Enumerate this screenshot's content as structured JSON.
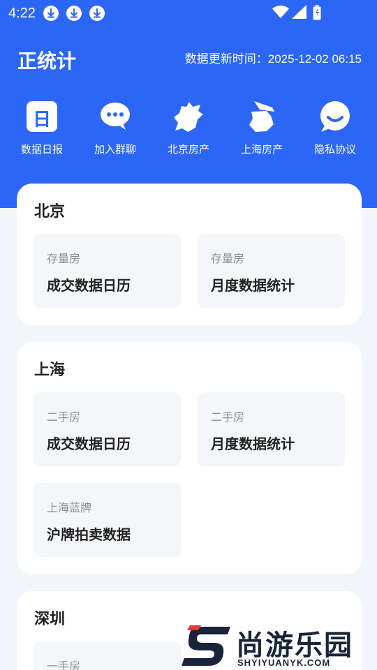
{
  "status_bar": {
    "time": "4:22",
    "notification_icons": [
      "download-icon",
      "download-icon",
      "download-icon"
    ],
    "system_icons": [
      "wifi-icon",
      "signal-icon",
      "battery-icon"
    ]
  },
  "header": {
    "title": "正统计",
    "update_label": "数据更新时间：",
    "update_time": "2025-12-02 06:15"
  },
  "shortcuts": [
    {
      "label": "数据日报",
      "icon": "calendar-day-icon",
      "glyph": "日"
    },
    {
      "label": "加入群聊",
      "icon": "chat-bubble-icon"
    },
    {
      "label": "北京房产",
      "icon": "beijing-map-icon"
    },
    {
      "label": "上海房产",
      "icon": "shanghai-map-icon"
    },
    {
      "label": "隐私协议",
      "icon": "smile-bubble-icon"
    }
  ],
  "cities": [
    {
      "name": "北京",
      "tiles": [
        {
          "sub": "存量房",
          "main": "成交数据日历"
        },
        {
          "sub": "存量房",
          "main": "月度数据统计"
        }
      ]
    },
    {
      "name": "上海",
      "tiles": [
        {
          "sub": "二手房",
          "main": "成交数据日历"
        },
        {
          "sub": "二手房",
          "main": "月度数据统计"
        },
        {
          "sub": "上海蓝牌",
          "main": "沪牌拍卖数据"
        }
      ]
    },
    {
      "name": "深圳",
      "tiles": [
        {
          "sub": "一手房",
          "main": ""
        }
      ]
    }
  ],
  "watermark": {
    "text": "尚游乐园",
    "url": "SHYIYUANYK.COM"
  },
  "colors": {
    "brand_blue": "#2b66f6",
    "page_bg": "#f2f5fa",
    "tile_bg": "#f4f6f9"
  }
}
